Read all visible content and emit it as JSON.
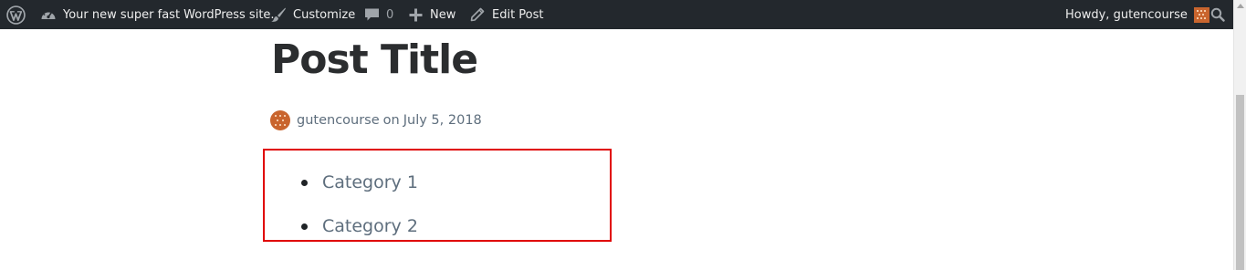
{
  "admin_bar": {
    "site_name": "Your new super fast WordPress site.",
    "customize_label": "Customize",
    "comments_count": "0",
    "new_label": "New",
    "edit_post_label": "Edit Post",
    "howdy_label": "Howdy, gutencourse",
    "icons": {
      "wp_logo": "wordpress-logo-icon",
      "dashboard": "dashboard-gauge-icon",
      "customize": "paintbrush-icon",
      "comments": "comment-bubble-icon",
      "new": "plus-icon",
      "edit": "pencil-icon",
      "avatar": "user-avatar-icon",
      "search": "search-icon"
    },
    "colors": {
      "background": "#23282d",
      "text": "#eeeeee",
      "dim_text": "#9ea3a8"
    }
  },
  "post": {
    "title": "Post Title",
    "author": "gutencourse",
    "on_text": "on",
    "date": "July 5, 2018",
    "categories": [
      "Category 1",
      "Category 2"
    ]
  },
  "colors": {
    "title": "#2b2d2f",
    "meta_text": "#5e6e7d",
    "highlight_border": "#e00000",
    "avatar": "#c9652e"
  }
}
